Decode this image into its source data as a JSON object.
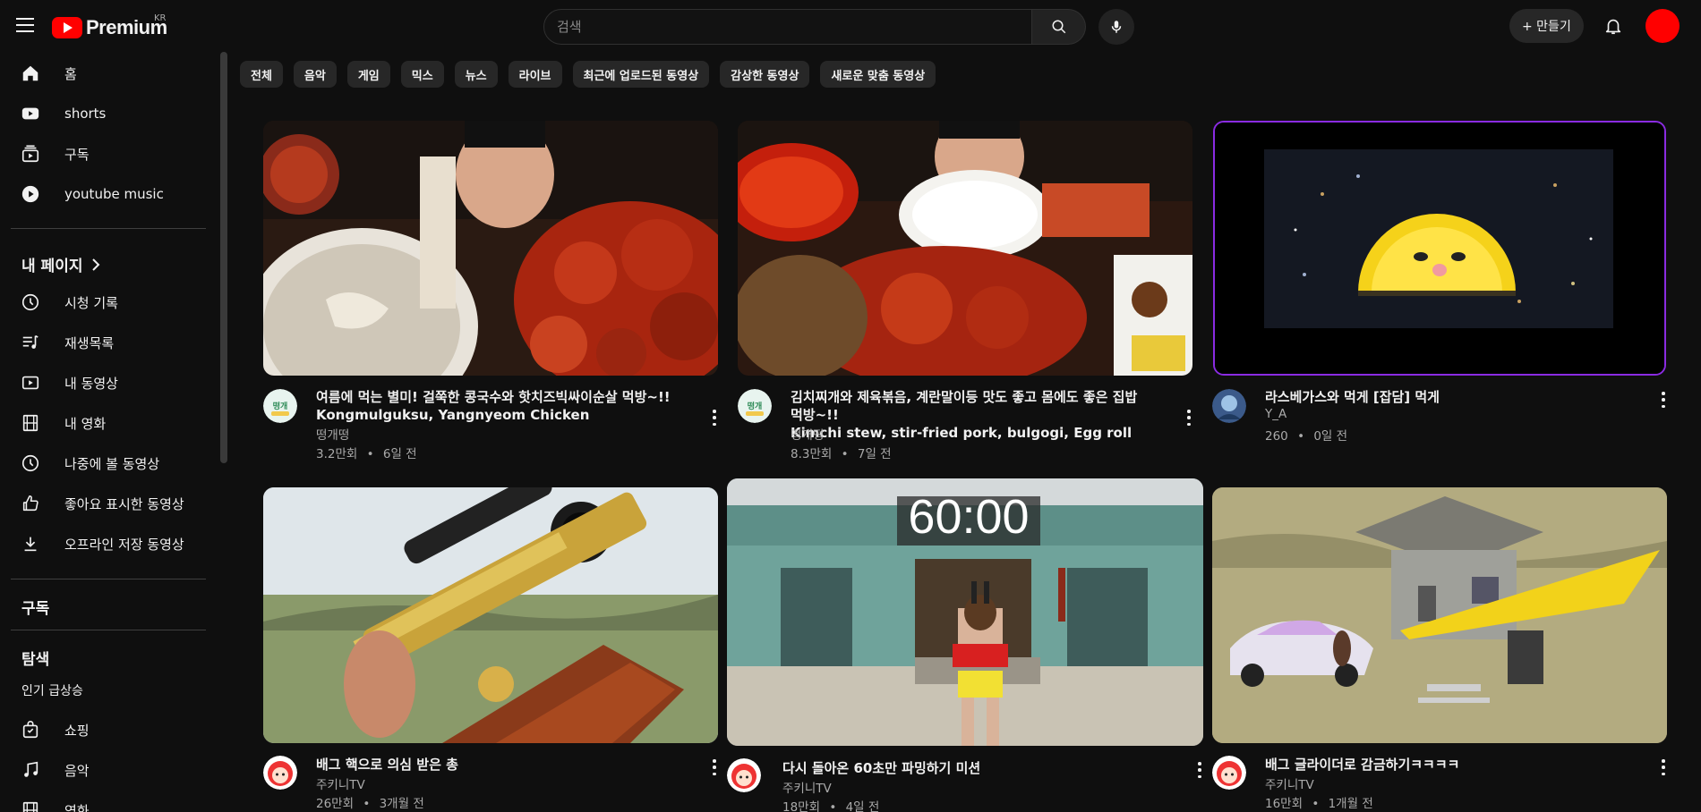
{
  "header": {
    "logo_text": "Premium",
    "logo_region": "KR",
    "search_placeholder": "검색",
    "create_label": "+ 만들기"
  },
  "sidebar": {
    "main_items": [
      {
        "label": "홈",
        "icon": "home-icon"
      },
      {
        "label": "shorts",
        "icon": "shorts-icon"
      },
      {
        "label": "구독",
        "icon": "subscriptions-icon"
      },
      {
        "label": "youtube music",
        "icon": "youtube-music-icon"
      }
    ],
    "my_page_heading": "내 페이지",
    "my_page_items": [
      {
        "label": "시청 기록",
        "icon": "history-icon"
      },
      {
        "label": "재생목록",
        "icon": "playlist-icon"
      },
      {
        "label": "내 동영상",
        "icon": "my-videos-icon"
      },
      {
        "label": "내 영화",
        "icon": "film-icon"
      },
      {
        "label": "나중에 볼 동영상",
        "icon": "watch-later-icon"
      },
      {
        "label": "좋아요 표시한 동영상",
        "icon": "like-icon"
      },
      {
        "label": "오프라인 저장 동영상",
        "icon": "download-icon"
      }
    ],
    "subscriptions_heading": "구독",
    "explore_heading": "탐색",
    "explore_sub": "인기 급상승",
    "explore_items": [
      {
        "label": "쇼핑",
        "icon": "shopping-bag-icon"
      },
      {
        "label": "음악",
        "icon": "music-note-icon"
      },
      {
        "label": "영화",
        "icon": "film-icon"
      }
    ]
  },
  "chips": [
    "전체",
    "음악",
    "게임",
    "믹스",
    "뉴스",
    "라이브",
    "최근에 업로드된 동영상",
    "감상한 동영상",
    "새로운 맞춤 동영상"
  ],
  "videos": [
    {
      "title_line1": "여름에 먹는 별미! 걸쭉한 콩국수와 핫치즈빅싸이순살 먹방~!!",
      "title_line2": "Kongmulguksu, Yangnyeom Chicken",
      "channel": "떵개떵",
      "views": "3.2만회",
      "age": "6일 전"
    },
    {
      "title_line1": "김치찌개와 제육볶음, 계란말이등 맛도 좋고 몸에도 좋은 집밥 먹방~!!",
      "title_line2": "Kimchi stew, stir-fried pork, bulgogi, Egg roll",
      "channel": "떵개떵",
      "views": "8.3만회",
      "age": "7일 전"
    },
    {
      "title_line1": "라스베가스와 먹게 [잡담] 먹게",
      "title_line2": "",
      "channel": "Y_A",
      "views": "260",
      "age": "0일 전"
    },
    {
      "title_line1": "배그 핵으로 의심 받은 총",
      "title_line2": "",
      "channel": "주키니TV",
      "views": "26만회",
      "age": "3개월 전"
    },
    {
      "title_line1": "다시 돌아온 60초만 파밍하기 미션",
      "title_line2": "",
      "channel": "주키니TV",
      "views": "18만회",
      "age": "4일 전",
      "overlay_text": "60:00"
    },
    {
      "title_line1": "배그 글라이더로 감금하기ㅋㅋㅋㅋ",
      "title_line2": "",
      "channel": "주키니TV",
      "views": "16만회",
      "age": "1개월 전"
    }
  ],
  "meta_separator": "•",
  "colors": {
    "brand": "#ff0000",
    "background": "#0f0f0f",
    "chip": "#272727"
  }
}
